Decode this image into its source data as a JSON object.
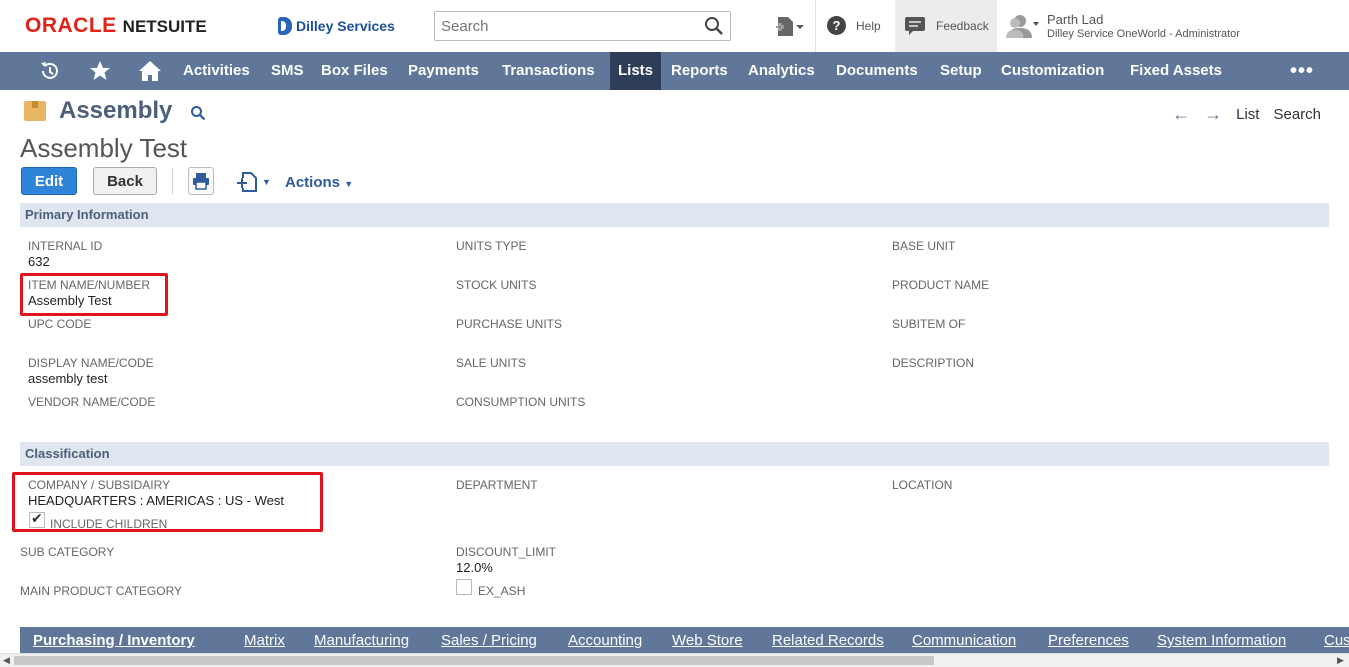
{
  "header": {
    "brand": "ORACLE",
    "product": "NETSUITE",
    "company": "Dilley Services",
    "search_placeholder": "Search",
    "help_label": "Help",
    "feedback_label": "Feedback",
    "user_name": "Parth Lad",
    "user_role": "Dilley Service OneWorld - Administrator"
  },
  "nav": {
    "items": [
      "Activities",
      "SMS",
      "Box Files",
      "Payments",
      "Transactions",
      "Lists",
      "Reports",
      "Analytics",
      "Documents",
      "Setup",
      "Customization",
      "Fixed Assets"
    ],
    "active": "Lists",
    "more": "•••"
  },
  "page": {
    "record_type": "Assembly",
    "record_title": "Assembly Test",
    "pager_list": "List",
    "pager_search": "Search",
    "edit_label": "Edit",
    "back_label": "Back",
    "actions_label": "Actions"
  },
  "primary": {
    "section_title": "Primary Information",
    "internal_id_label": "INTERNAL ID",
    "internal_id_value": "632",
    "item_name_label": "ITEM NAME/NUMBER",
    "item_name_value": "Assembly Test",
    "upc_label": "UPC CODE",
    "display_name_label": "DISPLAY NAME/CODE",
    "display_name_value": "assembly test",
    "vendor_name_label": "VENDOR NAME/CODE",
    "units_type_label": "UNITS TYPE",
    "stock_units_label": "STOCK UNITS",
    "purchase_units_label": "PURCHASE UNITS",
    "sale_units_label": "SALE UNITS",
    "consumption_units_label": "CONSUMPTION UNITS",
    "base_unit_label": "BASE UNIT",
    "product_name_label": "PRODUCT NAME",
    "subitem_of_label": "SUBITEM OF",
    "description_label": "DESCRIPTION"
  },
  "classification": {
    "section_title": "Classification",
    "subsidiary_label": "COMPANY / SUBSIDAIRY",
    "subsidiary_value": "HEADQUARTERS : AMERICAS : US - West",
    "include_children_label": "INCLUDE CHILDREN",
    "include_children_checked": true,
    "department_label": "DEPARTMENT",
    "location_label": "LOCATION",
    "sub_category_label": "SUB CATEGORY",
    "discount_limit_label": "DISCOUNT_LIMIT",
    "discount_limit_value": "12.0%",
    "main_category_label": "MAIN PRODUCT CATEGORY",
    "ex_ash_label": "EX_ASH",
    "ex_ash_checked": false
  },
  "subtabs": {
    "items": [
      "Purchasing / Inventory",
      "Matrix",
      "Manufacturing",
      "Sales / Pricing",
      "Accounting",
      "Web Store",
      "Related Records",
      "Communication",
      "Preferences",
      "System Information",
      "Cus"
    ],
    "active": "Purchasing / Inventory"
  },
  "colors": {
    "nav_bg": "#607799",
    "nav_active": "#2e3e59",
    "section_bg": "#e0e6ef",
    "highlight_red": "#e0151b",
    "edit_blue": "#2f84d8"
  }
}
